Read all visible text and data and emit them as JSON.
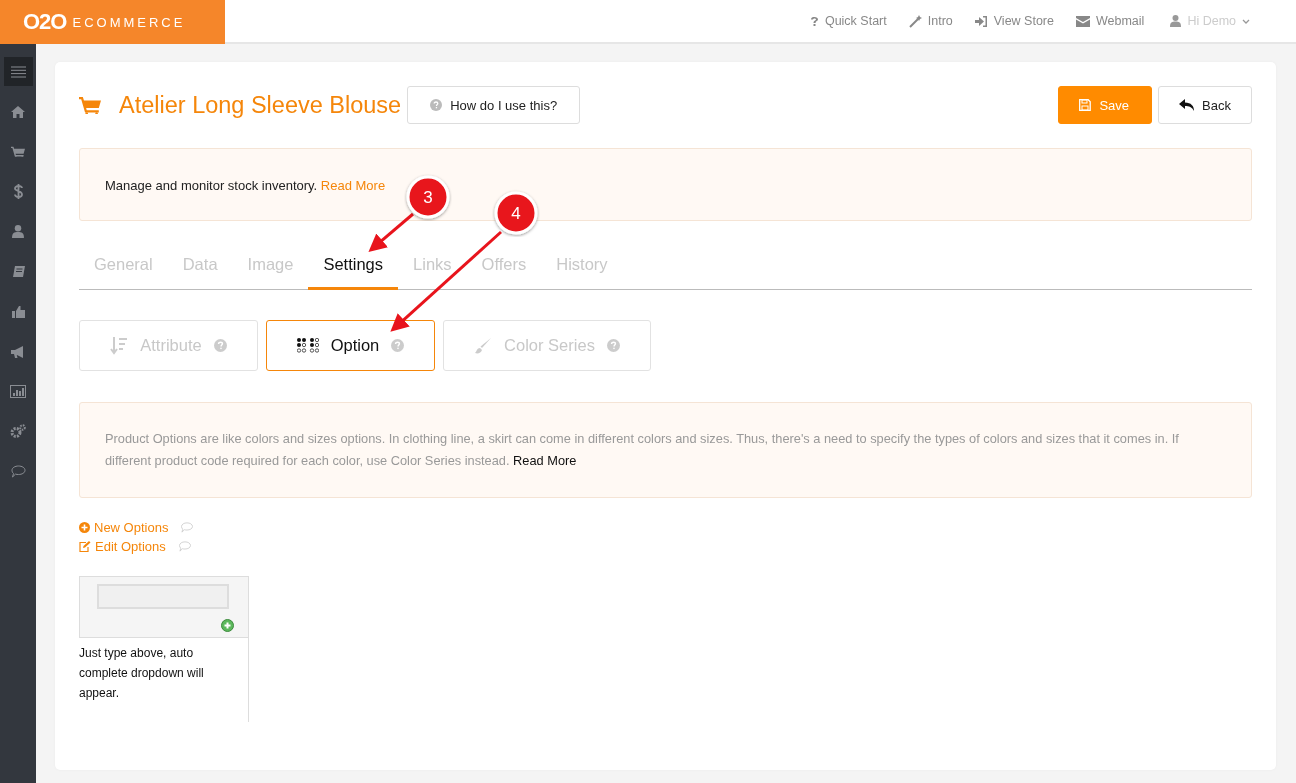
{
  "brand": {
    "logo_mark": "O2O",
    "logo_text": "ECOMMERCE"
  },
  "top_links": [
    {
      "label": "Quick Start"
    },
    {
      "label": "Intro"
    },
    {
      "label": "View Store"
    },
    {
      "label": "Webmail"
    }
  ],
  "user_menu": {
    "label": "Hi Demo"
  },
  "page": {
    "title": "Atelier Long Sleeve Blouse",
    "help_button": "How do I use this?",
    "save_button": "Save",
    "back_button": "Back"
  },
  "notice": {
    "text": "Manage and monitor stock inventory.",
    "link": "Read More"
  },
  "tabs": [
    {
      "label": "General",
      "selected": false
    },
    {
      "label": "Data",
      "selected": false
    },
    {
      "label": "Image",
      "selected": false
    },
    {
      "label": "Settings",
      "selected": true
    },
    {
      "label": "Links",
      "selected": false
    },
    {
      "label": "Offers",
      "selected": false
    },
    {
      "label": "History",
      "selected": false
    }
  ],
  "option_tabs": [
    {
      "label": "Attribute",
      "selected": false
    },
    {
      "label": "Option",
      "selected": true
    },
    {
      "label": "Color Series",
      "selected": false
    }
  ],
  "info": {
    "text": "Product Options are like colors and sizes options. In clothing line, a skirt can come in different colors and sizes. Thus, there's a need to specify the types of colors and sizes that it comes in. If different product code required for each color, use Color Series instead.",
    "link": "Read More"
  },
  "actions": [
    {
      "label": "New Options"
    },
    {
      "label": "Edit Options"
    }
  ],
  "option_box": {
    "hint": "Just type above, auto complete dropdown will appear."
  },
  "annotations": [
    {
      "number": "3"
    },
    {
      "number": "4"
    }
  ]
}
